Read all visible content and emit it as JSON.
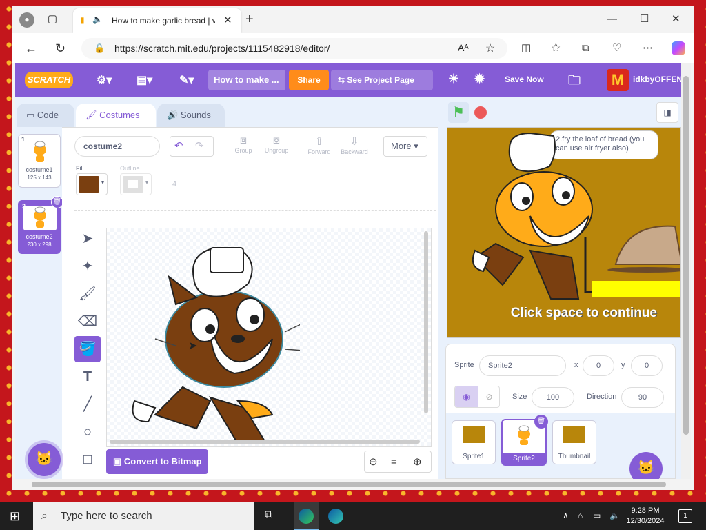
{
  "browser": {
    "tab_title": "How to make garlic bread | v",
    "new_tab": "+",
    "url": "https://scratch.mit.edu/projects/1115482918/editor/",
    "read_aloud": "Aᴬ",
    "minimize": "—",
    "maximize": "☐",
    "close": "✕"
  },
  "menubar": {
    "logo": "SCRATCH",
    "project_title": "How to make ...",
    "share": "Share",
    "see_project": "See Project Page",
    "save_now": "Save Now",
    "username": "idkbyOFFEN"
  },
  "editor_tabs": {
    "code": "Code",
    "costumes": "Costumes",
    "sounds": "Sounds"
  },
  "costumes": [
    {
      "num": "1",
      "name": "costume1",
      "size": "125 x 143"
    },
    {
      "num": "2",
      "name": "costume2",
      "size": "230 x 298"
    }
  ],
  "paint": {
    "costume_name": "costume2",
    "group": "Group",
    "ungroup": "Ungroup",
    "forward": "Forward",
    "backward": "Backward",
    "more": "More",
    "fill_label": "Fill",
    "outline_label": "Outline",
    "outline_width": "4",
    "fill_color": "#7a3f10",
    "convert": "Convert to Bitmap",
    "zoom_reset": "="
  },
  "stage": {
    "speech": "2.fry the loaf of bread (you can use air fryer also)",
    "caption": "Click space to continue"
  },
  "sprite_info": {
    "sprite_label": "Sprite",
    "sprite_name": "Sprite2",
    "x_label": "x",
    "x": "0",
    "y_label": "y",
    "y": "0",
    "show_label": "Show",
    "size_label": "Size",
    "size": "100",
    "direction_label": "Direction",
    "direction": "90"
  },
  "sprites": [
    {
      "name": "Sprite1"
    },
    {
      "name": "Sprite2"
    },
    {
      "name": "Thumbnail"
    }
  ],
  "taskbar": {
    "search_placeholder": "Type here to search",
    "time": "9:28 PM",
    "date": "12/30/2024",
    "notif_count": "1"
  }
}
